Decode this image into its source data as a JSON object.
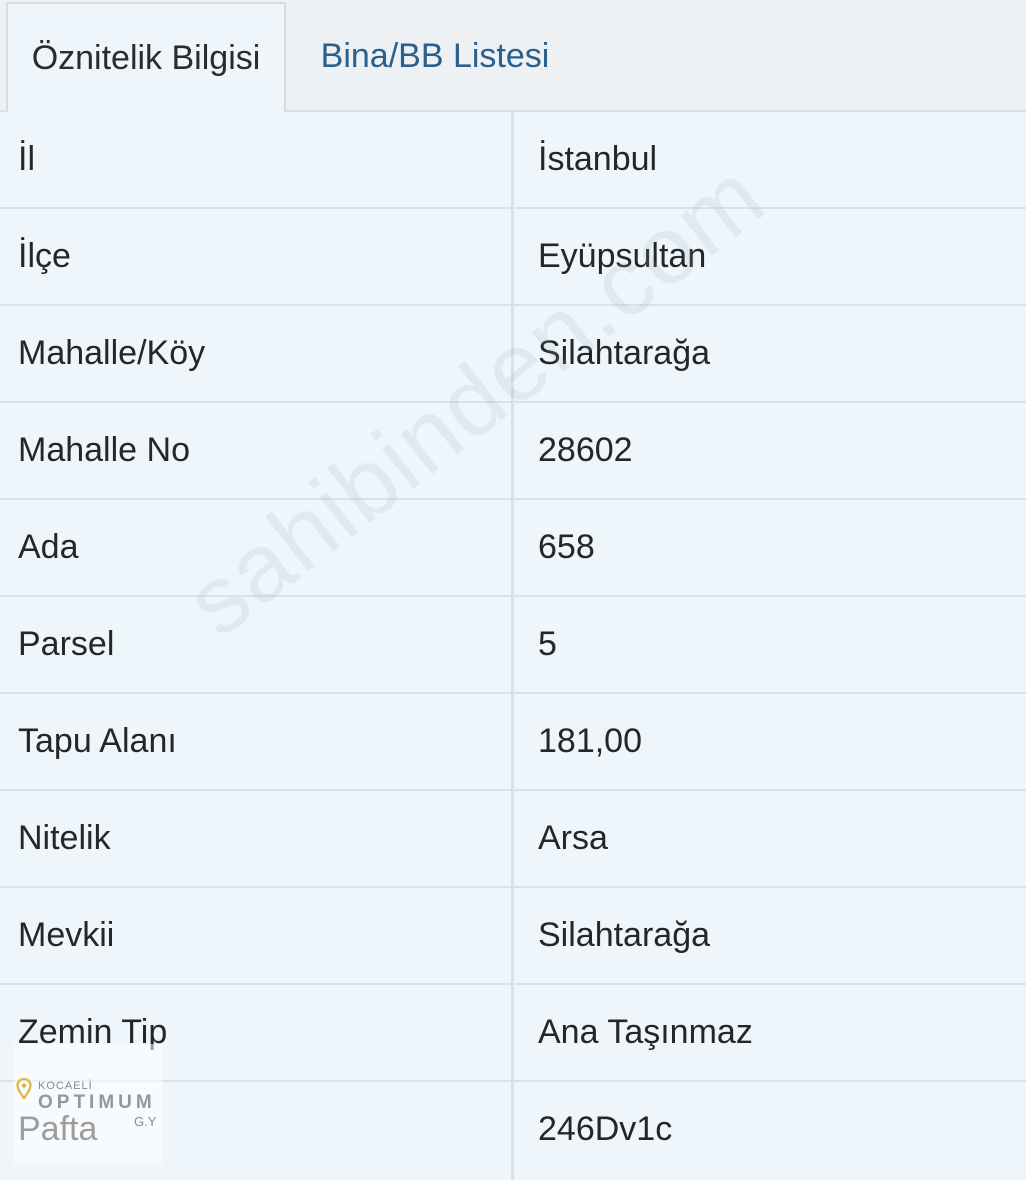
{
  "tabs": [
    {
      "label": "Öznitelik Bilgisi",
      "active": true
    },
    {
      "label": "Bina/BB Listesi",
      "active": false
    }
  ],
  "rows": [
    {
      "label": "İl",
      "value": "İstanbul"
    },
    {
      "label": "İlçe",
      "value": "Eyüpsultan"
    },
    {
      "label": "Mahalle/Köy",
      "value": "Silahtarağa"
    },
    {
      "label": "Mahalle No",
      "value": "28602"
    },
    {
      "label": "Ada",
      "value": "658"
    },
    {
      "label": "Parsel",
      "value": "5"
    },
    {
      "label": "Tapu Alanı",
      "value": "181,00"
    },
    {
      "label": "Nitelik",
      "value": "Arsa"
    },
    {
      "label": "Mevkii",
      "value": "Silahtarağa"
    },
    {
      "label": "Zemin Tip",
      "value": "Ana Taşınmaz"
    },
    {
      "label": "Pafta",
      "value": "246Dv1c"
    }
  ],
  "watermark": "sahibinden.com",
  "logo": {
    "sub": "KOCAELİ",
    "main": "OPTIMUM",
    "suffix": "G.Y"
  },
  "colors": {
    "background": "#eef6fb",
    "tab_link": "#2a5f8e",
    "divider": "#d8e2e8"
  }
}
